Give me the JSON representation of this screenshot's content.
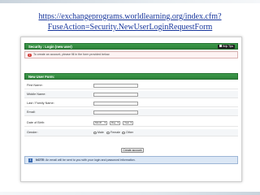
{
  "slide": {
    "url_text": "https://exchangeprograms.worldlearning.org/index.cfm?FuseAction=Security.NewUserLoginRequestForm"
  },
  "security": {
    "title": "Security : Login (new user)",
    "help_label": "Help Tips",
    "note": "To create an account, please fill in the form provided below."
  },
  "form": {
    "title": "New User Form:",
    "fields": [
      {
        "label": "First Name:",
        "value": ""
      },
      {
        "label": "Middle Name:",
        "value": ""
      },
      {
        "label": "Last / Family Name:",
        "value": ""
      },
      {
        "label": "Email:",
        "value": ""
      }
    ],
    "dob": {
      "label": "Date of Birth:",
      "month": "Month",
      "day": "Day",
      "year": "Year"
    },
    "gender": {
      "label": "Gender:",
      "options": [
        "Male",
        "Female",
        "Other"
      ]
    },
    "submit_label": "Create account"
  },
  "info": {
    "note_prefix": "NOTE:",
    "note_text": "An email will be sent to you with your login and password information."
  },
  "colors": {
    "header_green": "#2e8139",
    "link_blue": "#17369c",
    "info_blue": "#dbe7f5"
  }
}
